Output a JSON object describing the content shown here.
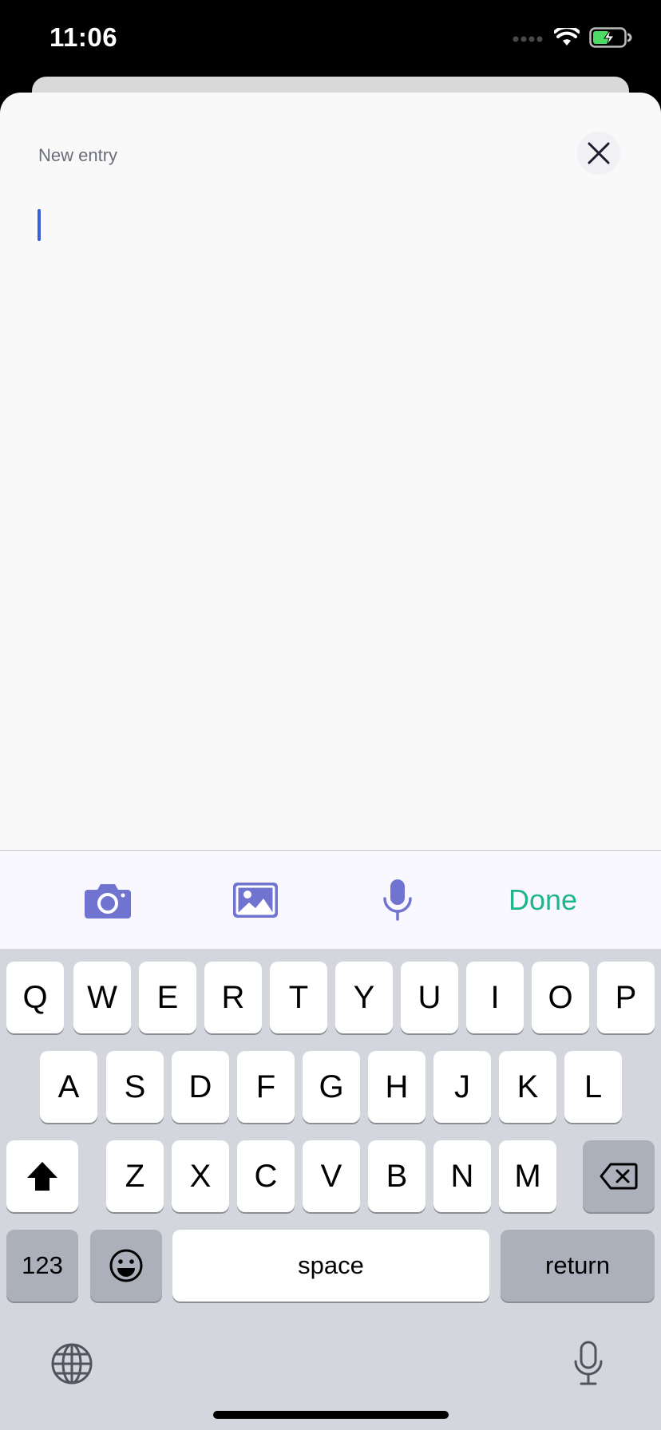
{
  "status_bar": {
    "time": "11:06",
    "icons": [
      "cellular-signal-icon",
      "wifi-icon",
      "battery-charging-icon"
    ]
  },
  "entry": {
    "title": "New entry",
    "text_value": "",
    "close_icon": "close-icon"
  },
  "toolbar": {
    "camera_icon": "camera-icon",
    "image_icon": "image-icon",
    "mic_icon": "microphone-icon",
    "done_label": "Done"
  },
  "keyboard": {
    "row1": [
      "Q",
      "W",
      "E",
      "R",
      "T",
      "Y",
      "U",
      "I",
      "O",
      "P"
    ],
    "row2": [
      "A",
      "S",
      "D",
      "F",
      "G",
      "H",
      "J",
      "K",
      "L"
    ],
    "row3": [
      "Z",
      "X",
      "C",
      "V",
      "B",
      "N",
      "M"
    ],
    "numbers_label": "123",
    "space_label": "space",
    "return_label": "return",
    "shift_icon": "shift-icon",
    "backspace_icon": "backspace-icon",
    "emoji_icon": "emoji-icon",
    "globe_icon": "globe-icon",
    "dictation_icon": "microphone-icon"
  },
  "colors": {
    "accent": "#7074d0",
    "done": "#22b58a",
    "cursor": "#3a5fd9",
    "sheet_background": "#f9f9f9",
    "keyboard_background": "#d3d6dd"
  }
}
